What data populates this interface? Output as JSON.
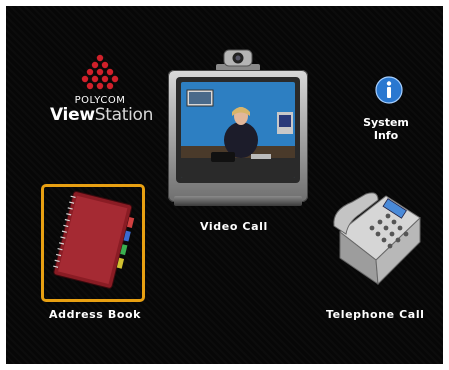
{
  "brand": {
    "company": "POLYCOM",
    "product_prefix": "View",
    "product_suffix": "Station",
    "logo_color": "#d0202a"
  },
  "menu": {
    "video_call": "Video Call",
    "system_info_line1": "System",
    "system_info_line2": "Info",
    "address_book": "Address Book",
    "telephone_call": "Telephone Call"
  },
  "icons": {
    "info": "info-icon",
    "tv": "television-icon",
    "address_book": "address-book-icon",
    "telephone": "telephone-icon",
    "camera": "camera-icon"
  },
  "colors": {
    "selection": "#e8a012",
    "background": "#070707",
    "info_blue": "#2a78d0"
  },
  "selected_item": "address_book"
}
